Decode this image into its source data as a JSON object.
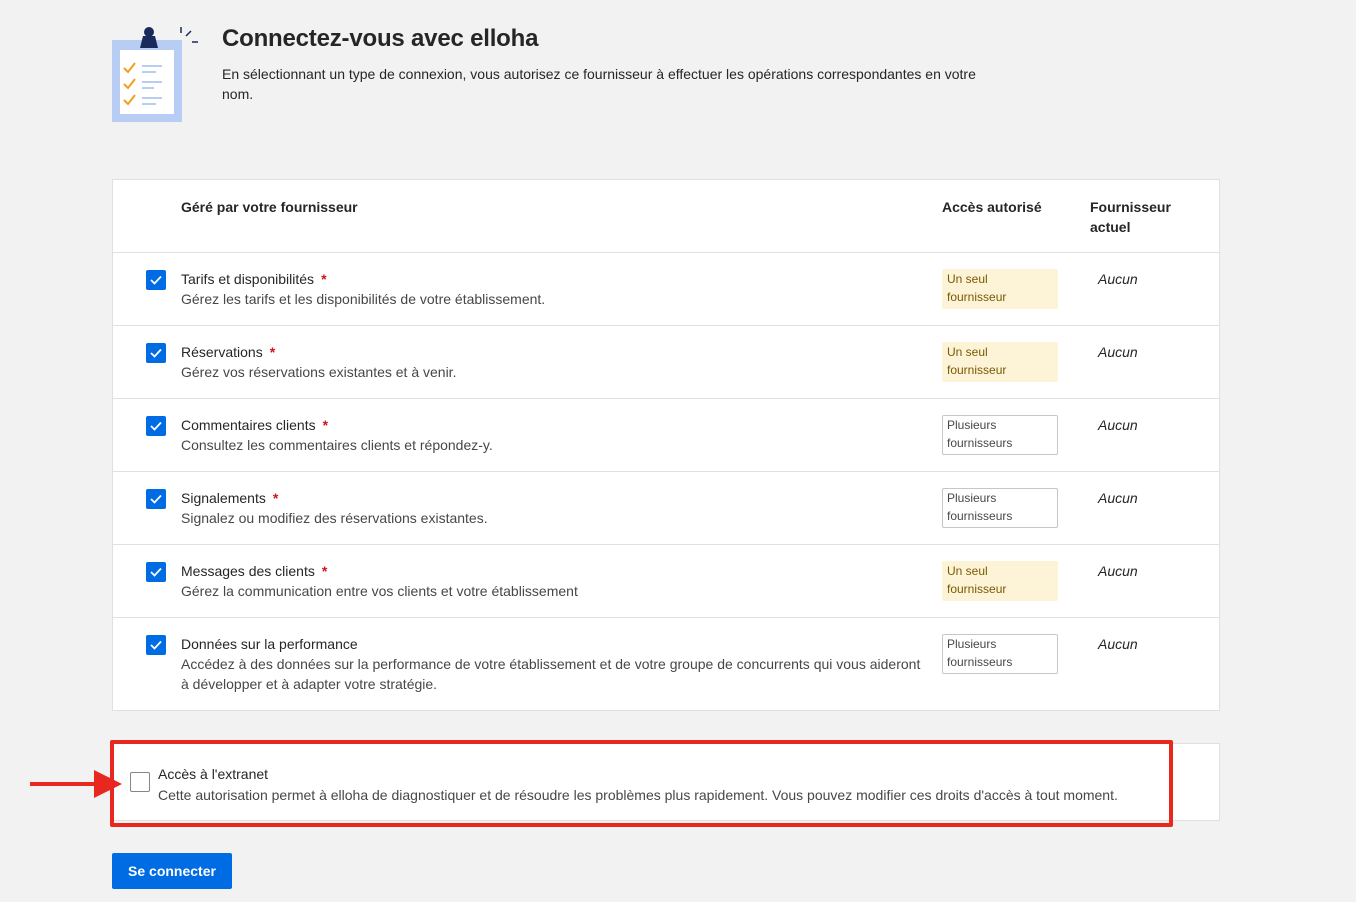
{
  "header": {
    "title": "Connectez-vous avec elloha",
    "intro": "En sélectionnant un type de connexion, vous autorisez ce fournisseur à effectuer les opérations correspondantes en votre nom."
  },
  "table": {
    "columns": {
      "managed": "Géré par votre fournisseur",
      "access": "Accès autorisé",
      "current_l1": "Fournisseur",
      "current_l2": "actuel"
    },
    "rows": [
      {
        "title": "Tarifs et disponibilités",
        "required": "*",
        "desc": "Gérez les tarifs et les disponibilités de votre établissement.",
        "access_l1": "Un seul",
        "access_l2": "fournisseur",
        "access_type": "single",
        "current": "Aucun",
        "checked": true
      },
      {
        "title": "Réservations",
        "required": "*",
        "desc": "Gérez vos réservations existantes et à venir.",
        "access_l1": "Un seul",
        "access_l2": "fournisseur",
        "access_type": "single",
        "current": "Aucun",
        "checked": true
      },
      {
        "title": "Commentaires clients",
        "required": "*",
        "desc": "Consultez les commentaires clients et répondez-y.",
        "access_l1": "Plusieurs",
        "access_l2": "fournisseurs",
        "access_type": "multi",
        "current": "Aucun",
        "checked": true
      },
      {
        "title": "Signalements",
        "required": "*",
        "desc": "Signalez ou modifiez des réservations existantes.",
        "access_l1": "Plusieurs",
        "access_l2": "fournisseurs",
        "access_type": "multi",
        "current": "Aucun",
        "checked": true
      },
      {
        "title": "Messages des clients",
        "required": "*",
        "desc": "Gérez la communication entre vos clients et votre établissement",
        "access_l1": "Un seul",
        "access_l2": "fournisseur",
        "access_type": "single",
        "current": "Aucun",
        "checked": true
      },
      {
        "title": "Données sur la performance",
        "required": "",
        "desc": "Accédez à des données sur la performance de votre établissement et de votre groupe de concurrents qui vous aideront à développer et à adapter votre stratégie.",
        "access_l1": "Plusieurs",
        "access_l2": "fournisseurs",
        "access_type": "multi",
        "current": "Aucun",
        "checked": true
      }
    ]
  },
  "extranet": {
    "title": "Accès à l'extranet",
    "desc": "Cette autorisation permet à elloha de diagnostiquer et de résoudre les problèmes plus rapidement. Vous pouvez modifier ces droits d'accès à tout moment.",
    "checked": false
  },
  "actions": {
    "connect_label": "Se connecter"
  },
  "icons": [
    "clipboard-checklist-icon",
    "checkmark-icon",
    "red-arrow-icon"
  ],
  "colors": {
    "primary": "#006ce4",
    "required": "#d4111e",
    "highlight": "#e8281f",
    "single_badge_bg": "#fdf4d8"
  }
}
